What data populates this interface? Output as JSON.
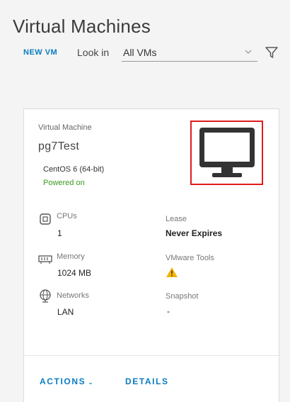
{
  "header": {
    "title": "Virtual Machines"
  },
  "toolbar": {
    "new_vm_label": "NEW VM",
    "look_in_label": "Look in",
    "look_in_value": "All VMs"
  },
  "card": {
    "type_label": "Virtual Machine",
    "name": "pg7Test",
    "os": "CentOS 6 (64-bit)",
    "power_state": "Powered on",
    "stats": {
      "cpus": {
        "label": "CPUs",
        "value": "1"
      },
      "memory": {
        "label": "Memory",
        "value": "1024 MB"
      },
      "networks": {
        "label": "Networks",
        "value": "LAN"
      },
      "lease": {
        "label": "Lease",
        "value": "Never Expires"
      },
      "vmware_tools": {
        "label": "VMware Tools",
        "status_icon": "warning-icon"
      },
      "snapshot": {
        "label": "Snapshot",
        "value": "-"
      }
    },
    "actions_label": "ACTIONS",
    "details_label": "DETAILS"
  },
  "colors": {
    "accent": "#0a7cc1",
    "powered_on": "#3b9a1f",
    "highlight_box": "#e01b1b",
    "warning": "#f5b301"
  }
}
